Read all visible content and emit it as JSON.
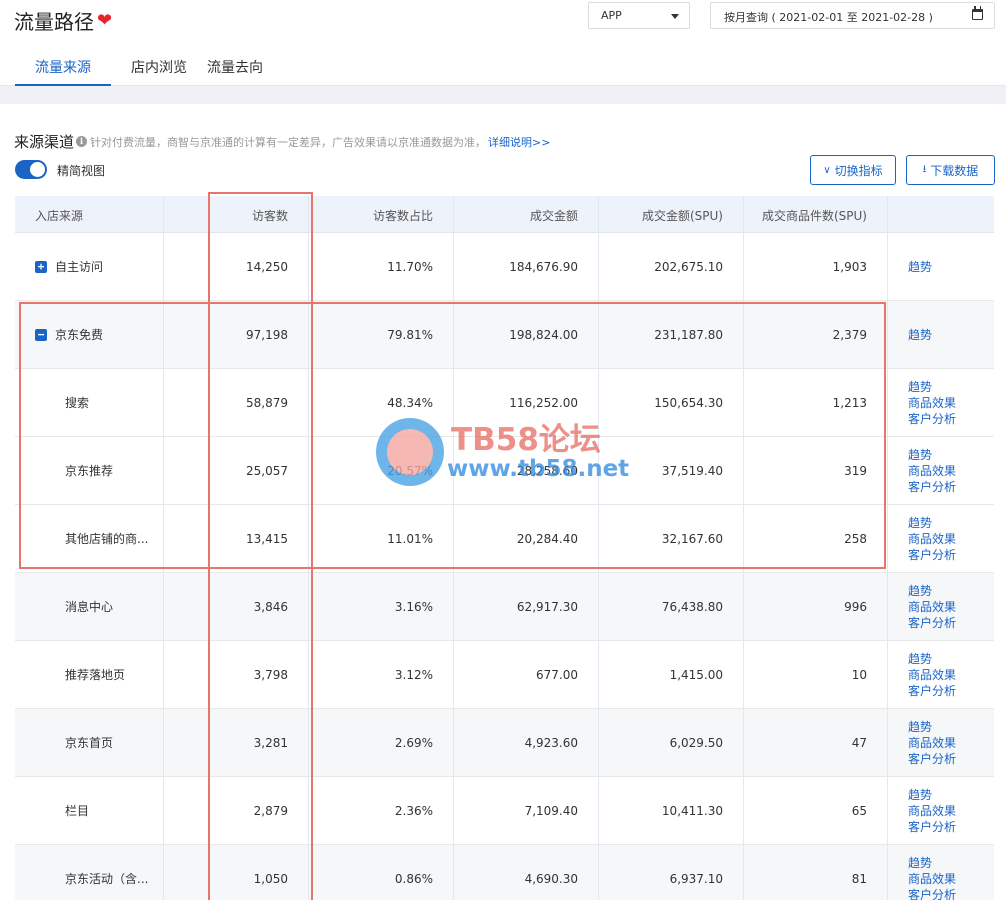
{
  "page": {
    "title": "流量路径",
    "platform": "APP",
    "date_range": "按月查询 ( 2021-02-01 至 2021-02-28 )",
    "tabs": [
      "流量来源",
      "店内浏览",
      "流量去向"
    ],
    "active_tab": "流量来源"
  },
  "section": {
    "title": "来源渠道",
    "note": "针对付费流量，商智与京准通的计算有一定差异，广告效果请以京准通数据为准，",
    "link": "详细说明>>",
    "toggle_label": "精简视图",
    "toggle_on": true,
    "switch_button": "切换指标",
    "download_button": "下载数据"
  },
  "table": {
    "headers": [
      "入店来源",
      "访客数",
      "访客数占比",
      "成交金额",
      "成交金额(SPU)",
      "成交商品件数(SPU)",
      ""
    ],
    "rows": [
      {
        "name": "自主访问",
        "expander": "+",
        "visitors": "14,250",
        "ratio": "11.70%",
        "amount": "184,676.90",
        "amount_spu": "202,675.10",
        "qty_spu": "1,903",
        "links": [
          "趋势"
        ]
      },
      {
        "name": "京东免费",
        "expander": "−",
        "visitors": "97,198",
        "ratio": "79.81%",
        "amount": "198,824.00",
        "amount_spu": "231,187.80",
        "qty_spu": "2,379",
        "links": [
          "趋势"
        ]
      },
      {
        "name": "搜索",
        "visitors": "58,879",
        "ratio": "48.34%",
        "amount": "116,252.00",
        "amount_spu": "150,654.30",
        "qty_spu": "1,213",
        "links": [
          "趋势",
          "商品效果",
          "客户分析"
        ]
      },
      {
        "name": "京东推荐",
        "visitors": "25,057",
        "ratio": "20.57%",
        "amount": "28,258.60",
        "amount_spu": "37,519.40",
        "qty_spu": "319",
        "links": [
          "趋势",
          "商品效果",
          "客户分析"
        ]
      },
      {
        "name": "其他店铺的商...",
        "visitors": "13,415",
        "ratio": "11.01%",
        "amount": "20,284.40",
        "amount_spu": "32,167.60",
        "qty_spu": "258",
        "links": [
          "趋势",
          "商品效果",
          "客户分析"
        ]
      },
      {
        "name": "消息中心",
        "visitors": "3,846",
        "ratio": "3.16%",
        "amount": "62,917.30",
        "amount_spu": "76,438.80",
        "qty_spu": "996",
        "links": [
          "趋势",
          "商品效果",
          "客户分析"
        ]
      },
      {
        "name": "推荐落地页",
        "visitors": "3,798",
        "ratio": "3.12%",
        "amount": "677.00",
        "amount_spu": "1,415.00",
        "qty_spu": "10",
        "links": [
          "趋势",
          "商品效果",
          "客户分析"
        ]
      },
      {
        "name": "京东首页",
        "visitors": "3,281",
        "ratio": "2.69%",
        "amount": "4,923.60",
        "amount_spu": "6,029.50",
        "qty_spu": "47",
        "links": [
          "趋势",
          "商品效果",
          "客户分析"
        ]
      },
      {
        "name": "栏目",
        "visitors": "2,879",
        "ratio": "2.36%",
        "amount": "7,109.40",
        "amount_spu": "10,411.30",
        "qty_spu": "65",
        "links": [
          "趋势",
          "商品效果",
          "客户分析"
        ]
      },
      {
        "name": "京东活动（含...",
        "visitors": "1,050",
        "ratio": "0.86%",
        "amount": "4,690.30",
        "amount_spu": "6,937.10",
        "qty_spu": "81",
        "links": [
          "趋势",
          "商品效果",
          "客户分析"
        ]
      }
    ]
  },
  "watermark": {
    "brand": "TB58论坛",
    "url": "www.tb58.net"
  },
  "colors": {
    "accent": "#1a64c7",
    "highlight": "#e8756c",
    "heart": "#e4252c"
  }
}
